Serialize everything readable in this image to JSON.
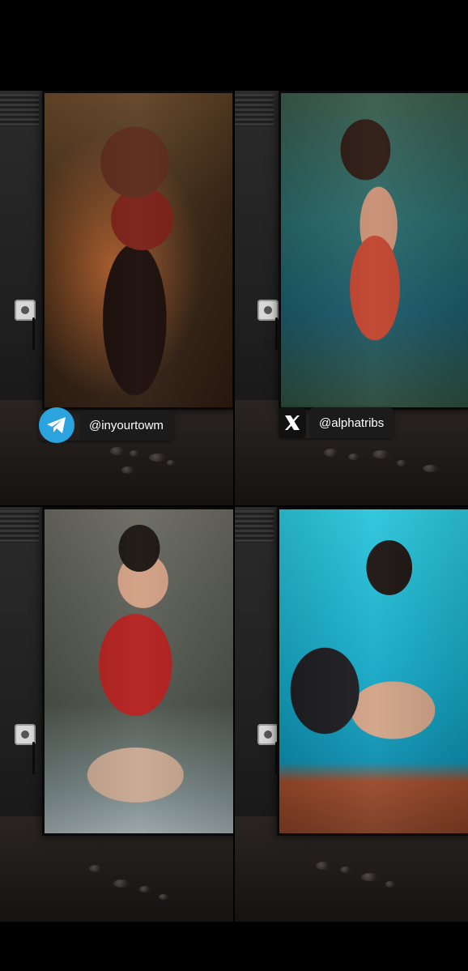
{
  "panels": [
    {
      "alt": "Woman in red and black costume lying on straw"
    },
    {
      "alt": "Woman in red beaded outfit against a carved temple backdrop"
    },
    {
      "alt": "Woman in red swimsuit sitting in water"
    },
    {
      "alt": "Woman in black swimsuit sitting by a blue pool"
    }
  ],
  "watermarks": {
    "telegram": {
      "handle": "@inyourtowm",
      "icon": "telegram-icon",
      "color": "#2aa3df"
    },
    "x": {
      "handle": "@alphatribs",
      "icon": "x-logo-icon"
    }
  }
}
